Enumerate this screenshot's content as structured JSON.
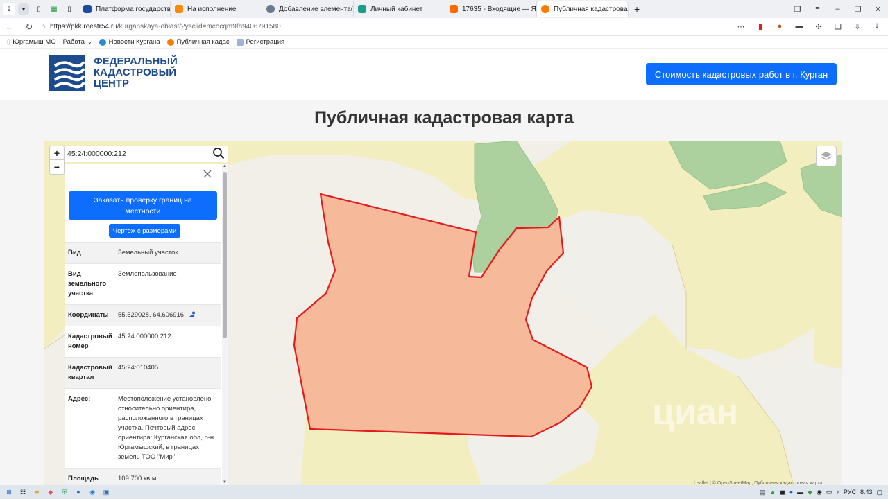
{
  "browser": {
    "tab_count": "9",
    "tabs": [
      {
        "title": "Платформа государстве",
        "color": "#1a4e9c"
      },
      {
        "title": "На исполнение",
        "color": "#ff8a00"
      },
      {
        "title": "Добавление элемента(он",
        "color": "#6b7a8f"
      },
      {
        "title": "Личный кабинет",
        "color": "#1e9c8a"
      },
      {
        "title": "17635 - Входящие — Янд",
        "color": "#ff6a00"
      },
      {
        "title": "Публичная кадастрова",
        "color": "#ff7a00"
      }
    ],
    "url_host": "https://pkk.reestr54.ru",
    "url_path": "/kurganskaya-oblast/?ysclid=mcocqm9fh9406791580",
    "bookmarks": [
      "Юргамыш МО",
      "Работа",
      "Новости Кургана",
      "Публичная кадас",
      "Регистрация"
    ]
  },
  "site": {
    "logo_line1": "ФЕДЕРАЛЬНЫЙ",
    "logo_line2": "КАДАСТРОВЫЙ",
    "logo_line3": "ЦЕНТР",
    "cta_label": "Стоимость кадастровых работ в г. Курган",
    "page_title": "Публичная кадастровая карта",
    "brand_color": "#1d4c8e",
    "accent_color": "#0d6efd"
  },
  "map": {
    "zoom_in": "+",
    "zoom_out": "−",
    "search_value": "45:24:000000:212",
    "parcel_fill": "#f6b99a",
    "parcel_stroke": "#e21c1c",
    "attribution": "Leaflet | © OpenStreetMap, Публичная кадастровая карта",
    "watermark": "циан"
  },
  "panel": {
    "order_button": "Заказать проверку границ на местности",
    "drawing_button": "Чертеж с размерами",
    "rows": [
      {
        "key": "Вид",
        "value": "Земельный участок"
      },
      {
        "key": "Вид земельного участка",
        "value": "Землепользование"
      },
      {
        "key": "Координаты",
        "value": "55.529028, 64.606916"
      },
      {
        "key": "Кадастровый номер",
        "value": "45:24:000000:212"
      },
      {
        "key": "Кадастровый квартал",
        "value": "45:24:010405"
      },
      {
        "key": "Адрес:",
        "value": "Местоположение установлено относительно ориентира, расположенного в границах участка. Почтовый адрес ориентира: Курганская обл, р-н Юргамышский, в границах земель ТОО \"Мир\"."
      },
      {
        "key": "Площадь уточненная:",
        "value": "109 700 кв.м."
      }
    ]
  },
  "taskbar": {
    "lang": "РУС",
    "time": "8:43"
  }
}
